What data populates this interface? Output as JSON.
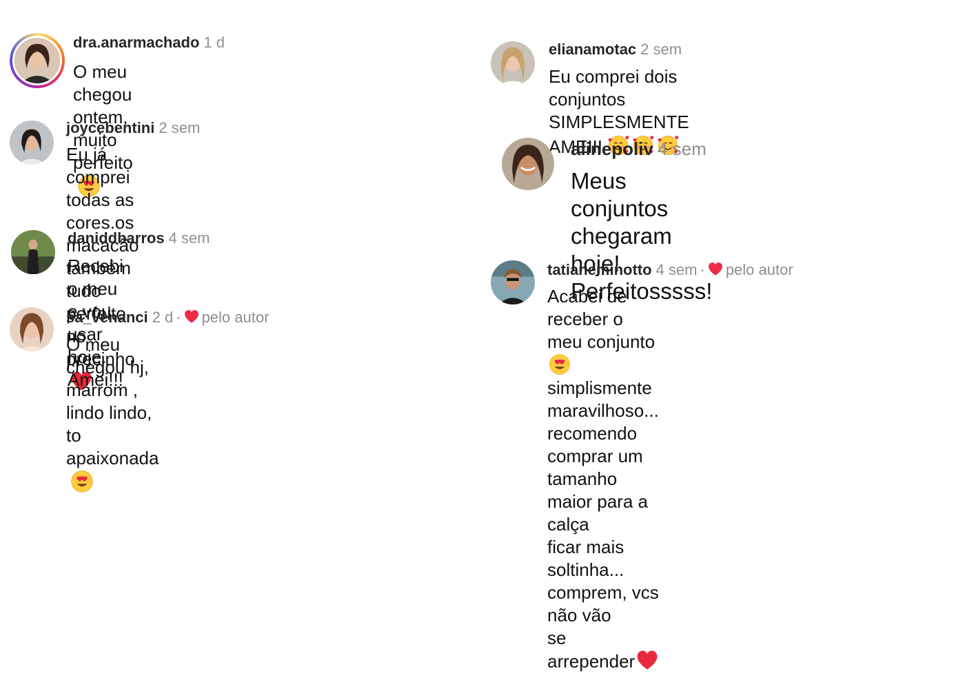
{
  "liked_by_author_label": "pelo autor",
  "comments": [
    {
      "username": "dra.anarmachado",
      "time": "1 d",
      "text": "O meu chegou ontem, muito perfeito",
      "emoji": "heart-eyes"
    },
    {
      "username": "joycebentini",
      "time": "2 sem",
      "text_lines": [
        "Eu já comprei todas as cores.os macacão",
        "também tudo perfeito no precinho"
      ],
      "emoji": "red-heart"
    },
    {
      "username": "daniddbarros",
      "time": "4 sem",
      "text": "Recebi o meu e vou usar hoje. Amei!!!"
    },
    {
      "username": "sa_venanci",
      "time": "2 d",
      "liked_by_author": true,
      "text_lines": [
        "O meu chegou hj, marrom , lindo lindo, to",
        "apaixonada"
      ],
      "emoji": "heart-eyes"
    },
    {
      "username": "elianamotac",
      "time": "2 sem",
      "text_lines": [
        "Eu comprei dois conjuntos SIMPLESMENTE",
        "AMEIII"
      ],
      "emoji": "smiling-hearts x3"
    },
    {
      "username": "alinepoliv",
      "time": "4 sem",
      "text_lines": [
        "Meus conjuntos chegaram hoje!",
        "Perfeitosssss!"
      ]
    },
    {
      "username": "tatianeminotto",
      "time": "4 sem",
      "liked_by_author": true,
      "text_lines": [
        "Acabei de receber o meu conjunto",
        "simplismente maravilhoso... recomendo",
        "comprar um tamanho maior para a calça",
        "ficar mais soltinha... comprem, vcs não vão",
        "se arrepender"
      ],
      "emoji": "heart-eyes, red-heart"
    }
  ]
}
